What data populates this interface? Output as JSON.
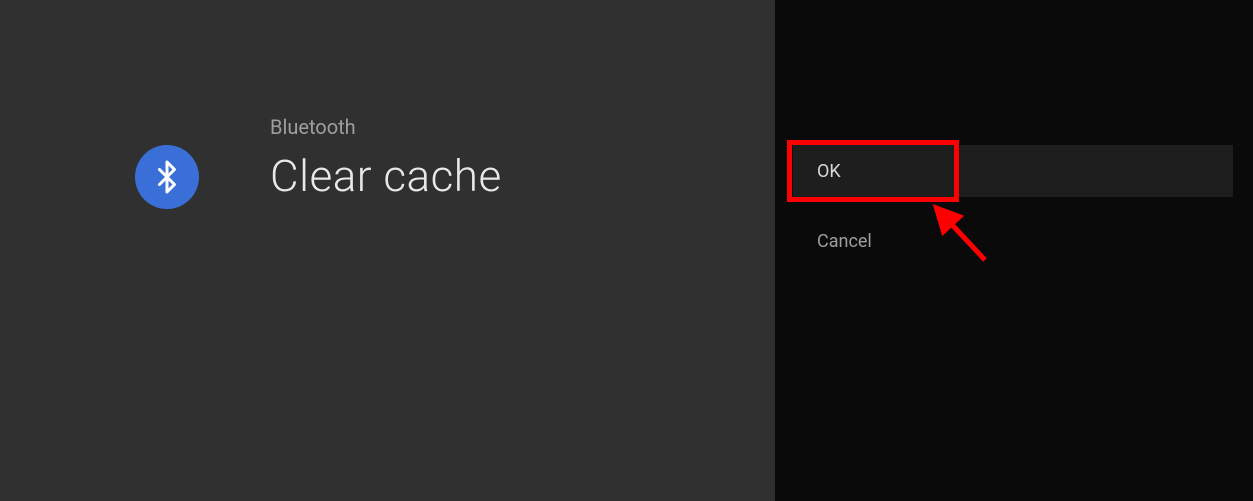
{
  "left": {
    "subtitle": "Bluetooth",
    "title": "Clear cache",
    "icon": "bluetooth-icon"
  },
  "right": {
    "ok_label": "OK",
    "cancel_label": "Cancel"
  }
}
